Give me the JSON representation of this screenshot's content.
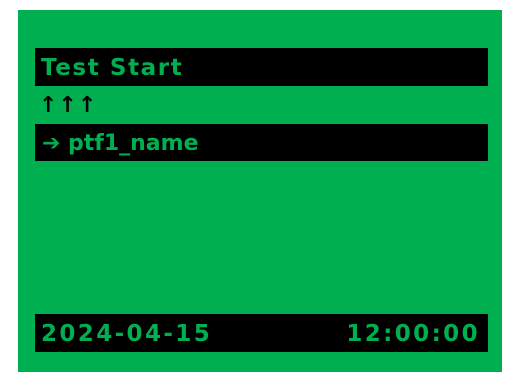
{
  "colors": {
    "screen_background": "#00b050",
    "bar_background": "#000000",
    "bar_text": "#00b050",
    "plain_text": "#000000"
  },
  "header": {
    "title": "Test Start"
  },
  "indicator": {
    "icon": "up-arrow-icon",
    "count": 3,
    "glyphs": "↑↑↑"
  },
  "menu": {
    "selected_icon": "right-arrow-icon",
    "selected_icon_glyph": "➔",
    "selected_item": "ptf1_name"
  },
  "status": {
    "date": "2024-04-15",
    "time": "12:00:00"
  }
}
